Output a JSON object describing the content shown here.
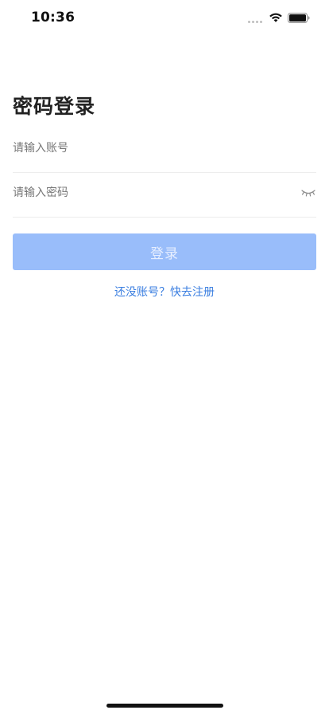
{
  "status_bar": {
    "time": "10:36"
  },
  "login": {
    "title": "密码登录",
    "account_placeholder": "请输入账号",
    "password_placeholder": "请输入密码",
    "submit_label": "登录",
    "register_prompt": "还没账号？快去注册"
  },
  "colors": {
    "accent": "#3a7ee0",
    "button_disabled_bg": "#99bdfa",
    "button_disabled_text": "#e7efff",
    "divider": "#ededed"
  },
  "icons": {
    "password_toggle": "eye-closed-icon",
    "wifi": "wifi-icon",
    "battery": "battery-icon"
  }
}
